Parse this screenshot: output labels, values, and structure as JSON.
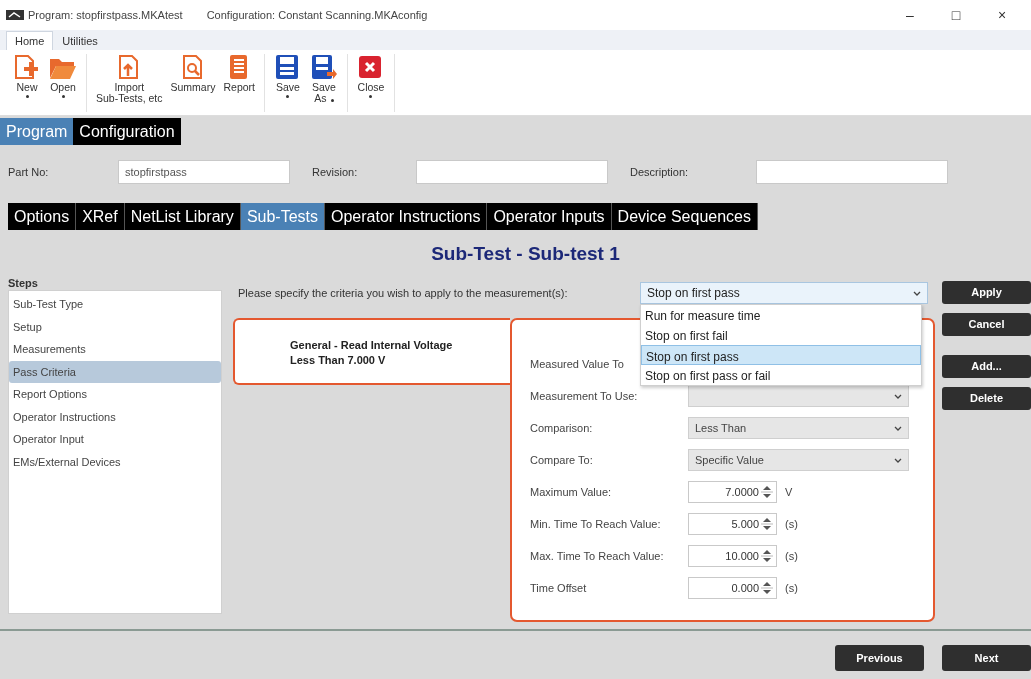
{
  "window": {
    "title_program": "Program: stopfirstpass.MKAtest",
    "title_configuration": "Configuration: Constant Scanning.MKAconfig",
    "controls": [
      "–",
      "□",
      "×"
    ]
  },
  "ribbon": {
    "tabs": [
      {
        "label": "Home",
        "selected": true
      },
      {
        "label": "Utilities",
        "selected": false
      }
    ],
    "groups": [
      [
        {
          "kind": "new",
          "lines": [
            "New"
          ],
          "dropdown": true
        },
        {
          "kind": "open",
          "lines": [
            "Open"
          ],
          "dropdown": true
        }
      ],
      [
        {
          "kind": "import",
          "lines": [
            "Import",
            "Sub-Tests, etc"
          ],
          "dropdown": false
        },
        {
          "kind": "summary",
          "lines": [
            "Summary"
          ],
          "dropdown": false
        },
        {
          "kind": "report",
          "lines": [
            "Report"
          ],
          "dropdown": false
        }
      ],
      [
        {
          "kind": "save",
          "lines": [
            "Save"
          ],
          "dropdown": true
        },
        {
          "kind": "saveas",
          "lines": [
            "Save",
            "As"
          ],
          "dropdown": true
        }
      ],
      [
        {
          "kind": "close",
          "lines": [
            "Close"
          ],
          "dropdown": true
        }
      ]
    ]
  },
  "mode_tabs": [
    {
      "label": "Program",
      "selected": true
    },
    {
      "label": "Configuration",
      "selected": false
    }
  ],
  "fields": [
    {
      "label": "Part No:",
      "value": "stopfirstpass"
    },
    {
      "label": "Revision:"
    },
    {
      "label": "Description:"
    }
  ],
  "tabs": [
    {
      "label": "Options",
      "selected": false
    },
    {
      "label": "XRef",
      "selected": false
    },
    {
      "label": "NetList Library",
      "selected": false
    },
    {
      "label": "Sub-Tests",
      "selected": true
    },
    {
      "label": "Operator Instructions",
      "selected": false
    },
    {
      "label": "Operator Inputs",
      "selected": false
    },
    {
      "label": "Device Sequences",
      "selected": false
    }
  ],
  "heading": "Sub-Test - Sub-test 1",
  "steps": {
    "title": "Steps",
    "items": [
      {
        "label": "Sub-Test Type",
        "selected": false
      },
      {
        "label": "Setup",
        "selected": false
      },
      {
        "label": "Measurements",
        "selected": false
      },
      {
        "label": "Pass Criteria",
        "selected": true
      },
      {
        "label": "Report Options",
        "selected": false
      },
      {
        "label": "Operator Instructions",
        "selected": false
      },
      {
        "label": "Operator Input",
        "selected": false
      },
      {
        "label": "EMs/External Devices",
        "selected": false
      }
    ]
  },
  "criteria": {
    "prompt": "Please specify the criteria you wish to apply to the measurement(s):",
    "value": "Stop on first pass",
    "expanded": true,
    "options": [
      {
        "label": "Run for measure time",
        "selected": false
      },
      {
        "label": "Stop on first fail",
        "selected": false
      },
      {
        "label": "Stop on first pass",
        "selected": true
      },
      {
        "label": "Stop on first pass or fail",
        "selected": false
      }
    ]
  },
  "measurements": [
    {
      "lines": [
        "General - Read Internal Voltage",
        "Less Than 7.000 V"
      ],
      "selected": true
    }
  ],
  "form": [
    {
      "kind": "label",
      "label": "Measured Value To"
    },
    {
      "kind": "select",
      "label": "Measurement To Use:"
    },
    {
      "kind": "select",
      "label": "Comparison:",
      "value": "Less Than"
    },
    {
      "kind": "select",
      "label": "Compare To:",
      "value": "Specific Value"
    },
    {
      "kind": "spin",
      "label": "Maximum Value:",
      "value": "7.0000",
      "unit": "V"
    },
    {
      "kind": "spin",
      "label": "Min. Time To Reach Value:",
      "value": "5.000",
      "unit": "(s)"
    },
    {
      "kind": "spin",
      "label": "Max. Time To Reach Value:",
      "value": "10.000",
      "unit": "(s)"
    },
    {
      "kind": "spin",
      "label": "Time Offset",
      "value": "0.000",
      "unit": "(s)"
    }
  ],
  "actions": [
    [
      "Apply",
      "Cancel"
    ],
    [
      "Add...",
      "Delete"
    ]
  ],
  "nav": [
    "Previous",
    "Next"
  ]
}
